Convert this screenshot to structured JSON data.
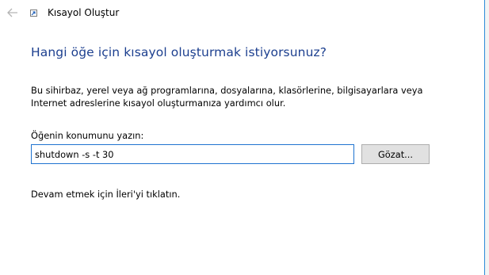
{
  "window": {
    "title": "Kısayol Oluştur"
  },
  "wizard": {
    "heading": "Hangi öğe için kısayol oluşturmak istiyorsunuz?",
    "description": "Bu sihirbaz, yerel veya ağ programlarına, dosyalarına, klasörlerine, bilgisayarlara veya Internet adreslerine kısayol oluşturmanıza yardımcı olur.",
    "location_label": "Öğenin konumunu yazın:",
    "location_value": "shutdown -s -t 30",
    "browse_label": "Gözat...",
    "hint": "Devam etmek için İleri'yi tıklatın."
  },
  "icons": {
    "back": "back-arrow-icon",
    "app": "shortcut-icon"
  },
  "colors": {
    "heading": "#1c3f8f",
    "input_border": "#1f73d0",
    "window_border": "#2b8ad8",
    "button_bg": "#e1e1e1"
  }
}
